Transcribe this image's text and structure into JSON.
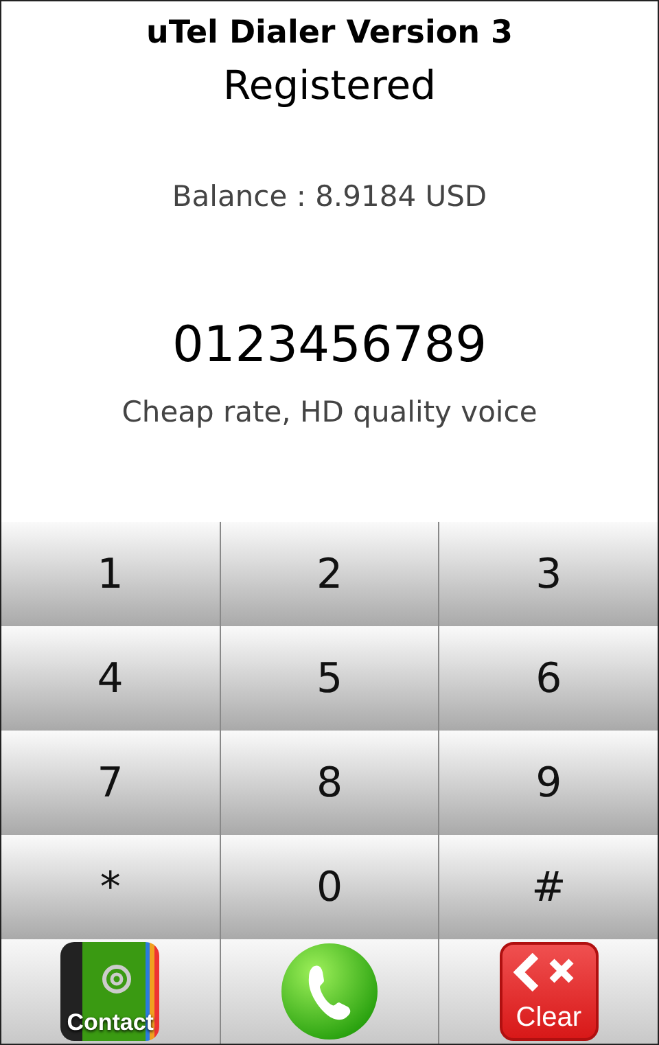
{
  "header": {
    "title": "uTel Dialer Version 3",
    "status": "Registered"
  },
  "balance": "Balance : 8.9184 USD",
  "dialed_number": "0123456789",
  "tagline": "Cheap rate, HD quality voice",
  "keys": [
    [
      "1",
      "2",
      "3"
    ],
    [
      "4",
      "5",
      "6"
    ],
    [
      "7",
      "8",
      "9"
    ],
    [
      "*",
      "0",
      "#"
    ]
  ],
  "actions": [
    {
      "kind": "contact",
      "label": "Contact"
    },
    {
      "kind": "call"
    },
    {
      "kind": "clear",
      "label": "Clear"
    }
  ]
}
